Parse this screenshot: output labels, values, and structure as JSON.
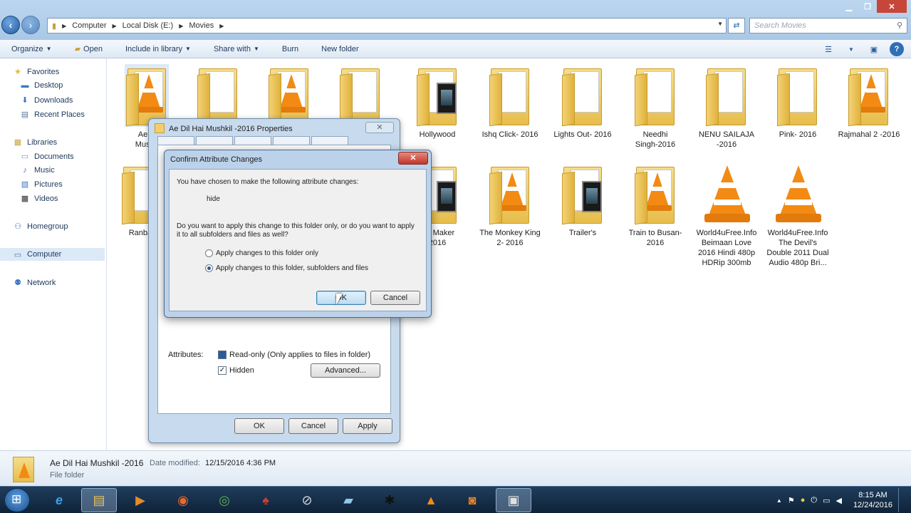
{
  "window": {
    "controls": {
      "minimize": "▁",
      "maximize": "❐",
      "close": "✕"
    }
  },
  "address": {
    "crumbs": [
      "Computer",
      "Local Disk (E:)",
      "Movies"
    ],
    "search_placeholder": "Search Movies"
  },
  "toolbar": {
    "organize": "Organize",
    "open": "Open",
    "include_in_library": "Include in library",
    "share_with": "Share with",
    "burn": "Burn",
    "new_folder": "New folder"
  },
  "sidebar": {
    "favorites": "Favorites",
    "desktop": "Desktop",
    "downloads": "Downloads",
    "recent_places": "Recent Places",
    "libraries": "Libraries",
    "documents": "Documents",
    "music": "Music",
    "pictures": "Pictures",
    "videos": "Videos",
    "homegroup": "Homegroup",
    "computer": "Computer",
    "network": "Network"
  },
  "files": {
    "row1": [
      {
        "name": "Ae D\nMushk",
        "kind": "folder-vlc"
      },
      {
        "name": "",
        "kind": "folder"
      },
      {
        "name": "",
        "kind": "folder-vlc"
      },
      {
        "name": "",
        "kind": "folder"
      },
      {
        "name": "Hollywood",
        "kind": "folder-film"
      },
      {
        "name": "Ishq Click- 2016",
        "kind": "folder"
      },
      {
        "name": "Lights Out- 2016",
        "kind": "folder"
      },
      {
        "name": "Needhi\nSingh-2016",
        "kind": "folder"
      },
      {
        "name": "NENU SAILAJA\n-2016",
        "kind": "folder"
      },
      {
        "name": "Pink- 2016",
        "kind": "folder"
      },
      {
        "name": "Rajmahal 2 -2016",
        "kind": "folder-vlc"
      }
    ],
    "row2": [
      {
        "name": "Ranban",
        "kind": "folder"
      },
      {
        "name": "ing Maker\n2016",
        "kind": "folder-film"
      },
      {
        "name": "The Monkey King\n2- 2016",
        "kind": "folder-vlc"
      },
      {
        "name": "Trailer's",
        "kind": "folder-film"
      },
      {
        "name": "Train to Busan-\n2016",
        "kind": "folder-vlc"
      },
      {
        "name": "World4uFree.Info\nBeimaan Love\n2016 Hindi 480p\nHDRip 300mb",
        "kind": "vlc"
      },
      {
        "name": "World4uFree.Info\nThe Devil's\nDouble 2011 Dual\nAudio 480p Bri...",
        "kind": "vlc"
      }
    ]
  },
  "status": {
    "name": "Ae Dil Hai Mushkil -2016",
    "date_label": "Date modified:",
    "date": "12/15/2016 4:36 PM",
    "type": "File folder"
  },
  "properties_dialog": {
    "title": "Ae Dil Hai Mushkil -2016 Properties",
    "attributes_label": "Attributes:",
    "readonly": "Read-only (Only applies to files in folder)",
    "hidden": "Hidden",
    "advanced": "Advanced...",
    "ok": "OK",
    "cancel": "Cancel",
    "apply": "Apply"
  },
  "confirm_dialog": {
    "title": "Confirm Attribute Changes",
    "intro": "You have chosen to make the following attribute changes:",
    "attribute": "hide",
    "question": "Do you want to apply this change to this folder only, or do you want to apply it to all subfolders and files as well?",
    "option_folder_only": "Apply changes to this folder only",
    "option_all": "Apply changes to this folder, subfolders and files",
    "selected_option": "option_all",
    "ok": "OK",
    "cancel": "Cancel"
  },
  "taskbar": {
    "time": "8:15 AM",
    "date": "12/24/2016"
  }
}
